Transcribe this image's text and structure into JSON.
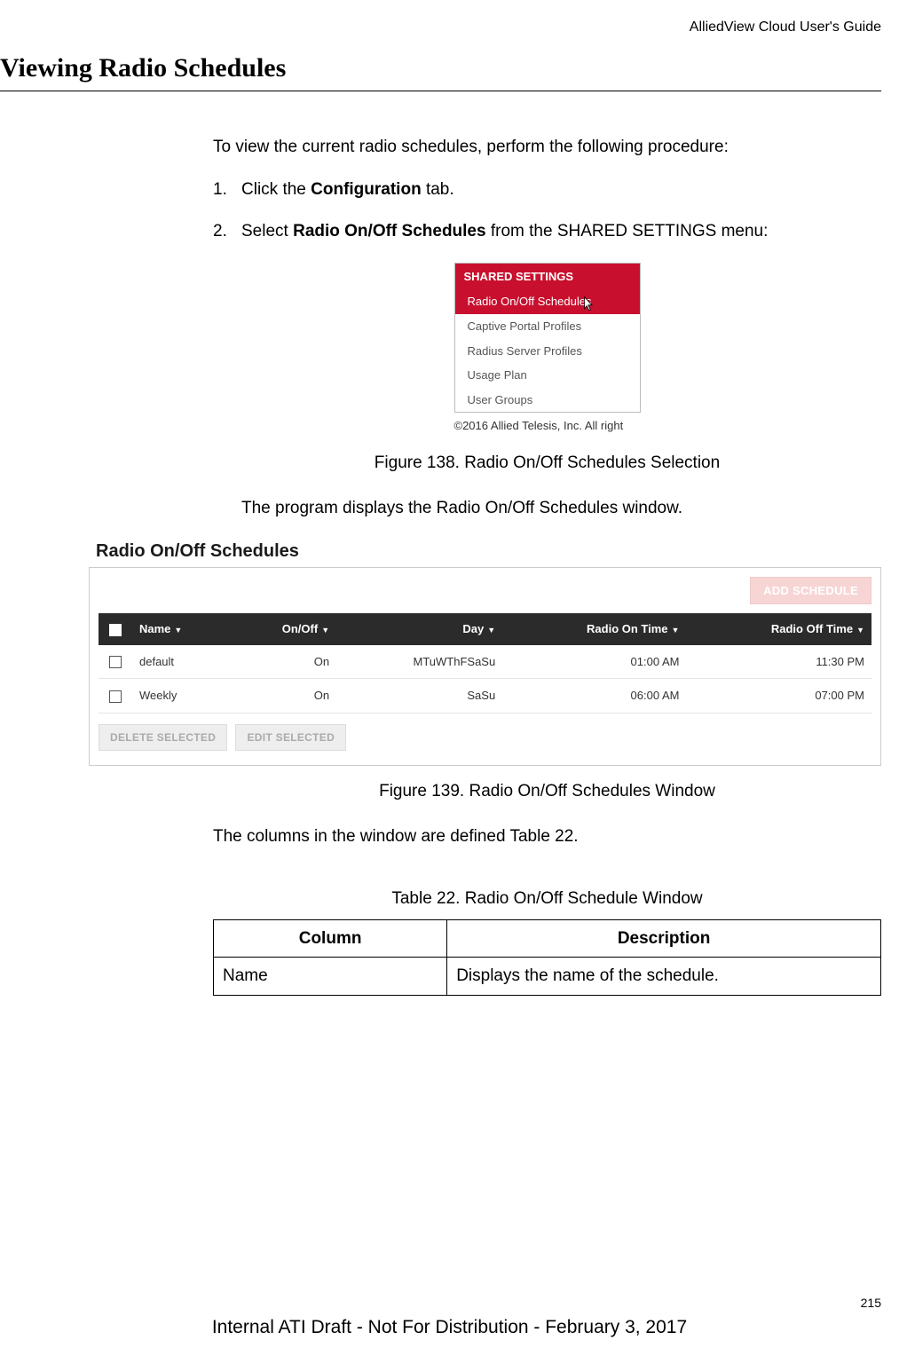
{
  "header": {
    "guide_title": "AlliedView Cloud User's Guide"
  },
  "section": {
    "title": "Viewing Radio Schedules"
  },
  "intro": "To view the current radio schedules, perform the following procedure:",
  "steps": {
    "s1_num": "1.",
    "s1_a": "Click the ",
    "s1_bold": "Configuration",
    "s1_b": " tab.",
    "s2_num": "2.",
    "s2_a": "Select ",
    "s2_bold": "Radio On/Off Schedules",
    "s2_b": " from the SHARED SETTINGS menu:"
  },
  "fig138": {
    "header": "SHARED SETTINGS",
    "items": {
      "i0": "Radio On/Off Schedules",
      "i1": "Captive Portal Profiles",
      "i2": "Radius Server Profiles",
      "i3": "Usage Plan",
      "i4": "User Groups"
    },
    "copyright": "©2016 Allied Telesis, Inc. All right",
    "caption": "Figure 138. Radio On/Off Schedules Selection"
  },
  "after_fig138": "The program displays the Radio On/Off Schedules window.",
  "fig139": {
    "panel_title": "Radio On/Off Schedules",
    "add_button": "ADD SCHEDULE",
    "columns": {
      "name": "Name",
      "onoff": "On/Off",
      "day": "Day",
      "on_time": "Radio On Time",
      "off_time": "Radio Off Time"
    },
    "rows": {
      "r0": {
        "name": "default",
        "onoff": "On",
        "day": "MTuWThFSaSu",
        "on_time": "01:00 AM",
        "off_time": "11:30 PM"
      },
      "r1": {
        "name": "Weekly",
        "onoff": "On",
        "day": "SaSu",
        "on_time": "06:00 AM",
        "off_time": "07:00 PM"
      }
    },
    "delete_btn": "DELETE SELECTED",
    "edit_btn": "EDIT SELECTED",
    "caption": "Figure 139. Radio On/Off Schedules Window"
  },
  "after_fig139": "The columns in the window are defined Table 22.",
  "table22": {
    "caption": "Table 22. Radio On/Off Schedule Window",
    "head_col": "Column",
    "head_desc": "Description",
    "row0_col": "Name",
    "row0_desc": "Displays the name of the schedule."
  },
  "footer": {
    "page_num": "215",
    "draft": "Internal ATI Draft - Not For Distribution - February 3, 2017"
  },
  "chart_data": {
    "type": "table",
    "title": "Radio On/Off Schedules",
    "columns": [
      "Name",
      "On/Off",
      "Day",
      "Radio On Time",
      "Radio Off Time"
    ],
    "rows": [
      [
        "default",
        "On",
        "MTuWThFSaSu",
        "01:00 AM",
        "11:30 PM"
      ],
      [
        "Weekly",
        "On",
        "SaSu",
        "06:00 AM",
        "07:00 PM"
      ]
    ]
  }
}
